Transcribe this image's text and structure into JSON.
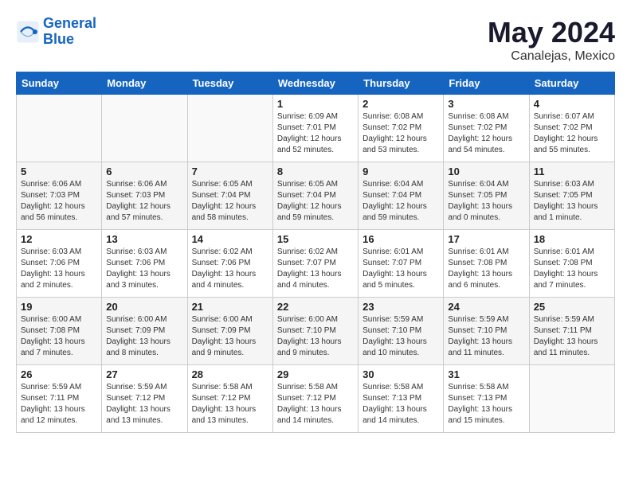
{
  "header": {
    "logo_text_general": "General",
    "logo_text_blue": "Blue",
    "month": "May 2024",
    "location": "Canalejas, Mexico"
  },
  "days_of_week": [
    "Sunday",
    "Monday",
    "Tuesday",
    "Wednesday",
    "Thursday",
    "Friday",
    "Saturday"
  ],
  "weeks": [
    [
      {
        "day": "",
        "info": ""
      },
      {
        "day": "",
        "info": ""
      },
      {
        "day": "",
        "info": ""
      },
      {
        "day": "1",
        "info": "Sunrise: 6:09 AM\nSunset: 7:01 PM\nDaylight: 12 hours\nand 52 minutes."
      },
      {
        "day": "2",
        "info": "Sunrise: 6:08 AM\nSunset: 7:02 PM\nDaylight: 12 hours\nand 53 minutes."
      },
      {
        "day": "3",
        "info": "Sunrise: 6:08 AM\nSunset: 7:02 PM\nDaylight: 12 hours\nand 54 minutes."
      },
      {
        "day": "4",
        "info": "Sunrise: 6:07 AM\nSunset: 7:02 PM\nDaylight: 12 hours\nand 55 minutes."
      }
    ],
    [
      {
        "day": "5",
        "info": "Sunrise: 6:06 AM\nSunset: 7:03 PM\nDaylight: 12 hours\nand 56 minutes."
      },
      {
        "day": "6",
        "info": "Sunrise: 6:06 AM\nSunset: 7:03 PM\nDaylight: 12 hours\nand 57 minutes."
      },
      {
        "day": "7",
        "info": "Sunrise: 6:05 AM\nSunset: 7:04 PM\nDaylight: 12 hours\nand 58 minutes."
      },
      {
        "day": "8",
        "info": "Sunrise: 6:05 AM\nSunset: 7:04 PM\nDaylight: 12 hours\nand 59 minutes."
      },
      {
        "day": "9",
        "info": "Sunrise: 6:04 AM\nSunset: 7:04 PM\nDaylight: 12 hours\nand 59 minutes."
      },
      {
        "day": "10",
        "info": "Sunrise: 6:04 AM\nSunset: 7:05 PM\nDaylight: 13 hours\nand 0 minutes."
      },
      {
        "day": "11",
        "info": "Sunrise: 6:03 AM\nSunset: 7:05 PM\nDaylight: 13 hours\nand 1 minute."
      }
    ],
    [
      {
        "day": "12",
        "info": "Sunrise: 6:03 AM\nSunset: 7:06 PM\nDaylight: 13 hours\nand 2 minutes."
      },
      {
        "day": "13",
        "info": "Sunrise: 6:03 AM\nSunset: 7:06 PM\nDaylight: 13 hours\nand 3 minutes."
      },
      {
        "day": "14",
        "info": "Sunrise: 6:02 AM\nSunset: 7:06 PM\nDaylight: 13 hours\nand 4 minutes."
      },
      {
        "day": "15",
        "info": "Sunrise: 6:02 AM\nSunset: 7:07 PM\nDaylight: 13 hours\nand 4 minutes."
      },
      {
        "day": "16",
        "info": "Sunrise: 6:01 AM\nSunset: 7:07 PM\nDaylight: 13 hours\nand 5 minutes."
      },
      {
        "day": "17",
        "info": "Sunrise: 6:01 AM\nSunset: 7:08 PM\nDaylight: 13 hours\nand 6 minutes."
      },
      {
        "day": "18",
        "info": "Sunrise: 6:01 AM\nSunset: 7:08 PM\nDaylight: 13 hours\nand 7 minutes."
      }
    ],
    [
      {
        "day": "19",
        "info": "Sunrise: 6:00 AM\nSunset: 7:08 PM\nDaylight: 13 hours\nand 7 minutes."
      },
      {
        "day": "20",
        "info": "Sunrise: 6:00 AM\nSunset: 7:09 PM\nDaylight: 13 hours\nand 8 minutes."
      },
      {
        "day": "21",
        "info": "Sunrise: 6:00 AM\nSunset: 7:09 PM\nDaylight: 13 hours\nand 9 minutes."
      },
      {
        "day": "22",
        "info": "Sunrise: 6:00 AM\nSunset: 7:10 PM\nDaylight: 13 hours\nand 9 minutes."
      },
      {
        "day": "23",
        "info": "Sunrise: 5:59 AM\nSunset: 7:10 PM\nDaylight: 13 hours\nand 10 minutes."
      },
      {
        "day": "24",
        "info": "Sunrise: 5:59 AM\nSunset: 7:10 PM\nDaylight: 13 hours\nand 11 minutes."
      },
      {
        "day": "25",
        "info": "Sunrise: 5:59 AM\nSunset: 7:11 PM\nDaylight: 13 hours\nand 11 minutes."
      }
    ],
    [
      {
        "day": "26",
        "info": "Sunrise: 5:59 AM\nSunset: 7:11 PM\nDaylight: 13 hours\nand 12 minutes."
      },
      {
        "day": "27",
        "info": "Sunrise: 5:59 AM\nSunset: 7:12 PM\nDaylight: 13 hours\nand 13 minutes."
      },
      {
        "day": "28",
        "info": "Sunrise: 5:58 AM\nSunset: 7:12 PM\nDaylight: 13 hours\nand 13 minutes."
      },
      {
        "day": "29",
        "info": "Sunrise: 5:58 AM\nSunset: 7:12 PM\nDaylight: 13 hours\nand 14 minutes."
      },
      {
        "day": "30",
        "info": "Sunrise: 5:58 AM\nSunset: 7:13 PM\nDaylight: 13 hours\nand 14 minutes."
      },
      {
        "day": "31",
        "info": "Sunrise: 5:58 AM\nSunset: 7:13 PM\nDaylight: 13 hours\nand 15 minutes."
      },
      {
        "day": "",
        "info": ""
      }
    ]
  ]
}
